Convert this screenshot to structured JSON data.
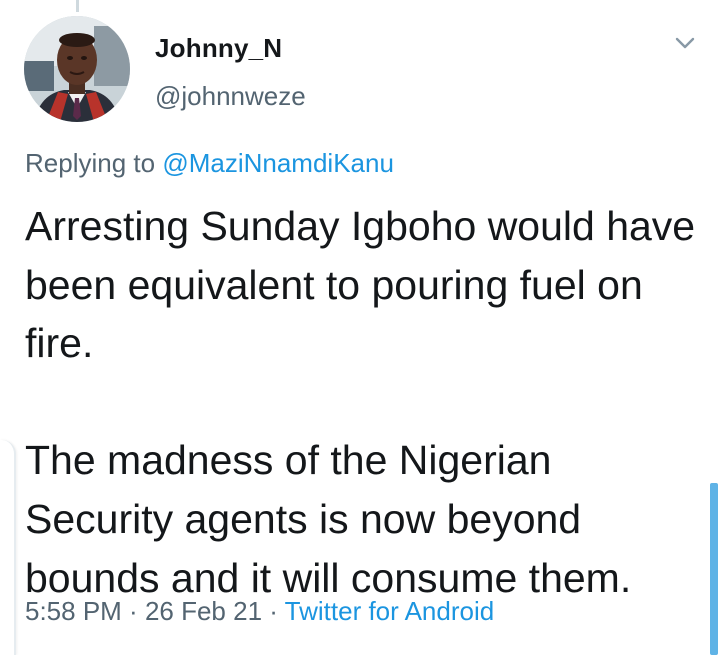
{
  "tweet": {
    "author": {
      "display_name": "Johnny_N",
      "handle": "@johnnweze",
      "avatar": "avatar-photo"
    },
    "replying_prefix": "Replying to ",
    "replying_to": "@MaziNnamdiKanu",
    "text_paragraphs": [
      "Arresting Sunday Igboho would have been equivalent to pouring fuel on fire.",
      "The madness of the Nigerian Security agents is now beyond bounds and it will consume them."
    ],
    "time": "5:58 PM",
    "separator": " · ",
    "date": "26 Feb 21",
    "source": "Twitter for Android",
    "menu_icon": "chevron-down-icon"
  },
  "colors": {
    "text": "#14171a",
    "secondary": "#536471",
    "link": "#1b95e0",
    "scroll_indicator": "#5fb3e6"
  }
}
